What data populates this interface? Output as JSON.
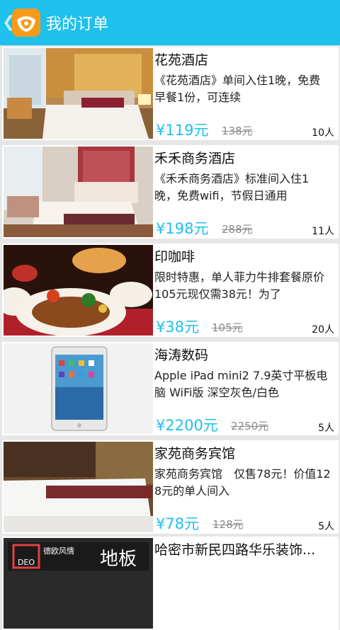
{
  "header": {
    "back_icon": "chevron-left-icon",
    "logo_icon": "app-logo-icon",
    "title": "我的订单"
  },
  "orders": [
    {
      "title": "花苑酒店",
      "desc": "《花苑酒店》单间入住1晚，免费早餐1份，可连续",
      "price": "¥119元",
      "original": "138元",
      "count": "10人"
    },
    {
      "title": "禾禾商务酒店",
      "desc": "《禾禾商务酒店》标准间入住1晚，免费wifi，节假日通用",
      "price": "¥198元",
      "original": "288元",
      "count": "11人"
    },
    {
      "title": "印咖啡",
      "desc": "限时特惠，单人菲力牛排套餐原价105元现仅需38元！为了",
      "price": "¥38元",
      "original": "105元",
      "count": "20人"
    },
    {
      "title": "海涛数码",
      "desc": "Apple iPad mini2 7.9英寸平板电脑 WiFi版 深空灰色/白色",
      "price": "¥2200元",
      "original": "2250元",
      "count": "5人"
    },
    {
      "title": "家苑商务宾馆",
      "desc": "家苑商务宾馆　仅售78元！价值128元的单人间入",
      "price": "¥78元",
      "original": "128元",
      "count": "5人"
    },
    {
      "title": "哈密市新民四路华乐装饰...",
      "desc": "",
      "price": "",
      "original": "",
      "count": ""
    }
  ],
  "thumb6_sign": {
    "small_text": "德欧风情",
    "big_text": "地板",
    "logo_text": "DEO"
  },
  "colors": {
    "accent": "#1ec0ec",
    "logo": "#f79a1c",
    "background": "#e6e6e6"
  }
}
